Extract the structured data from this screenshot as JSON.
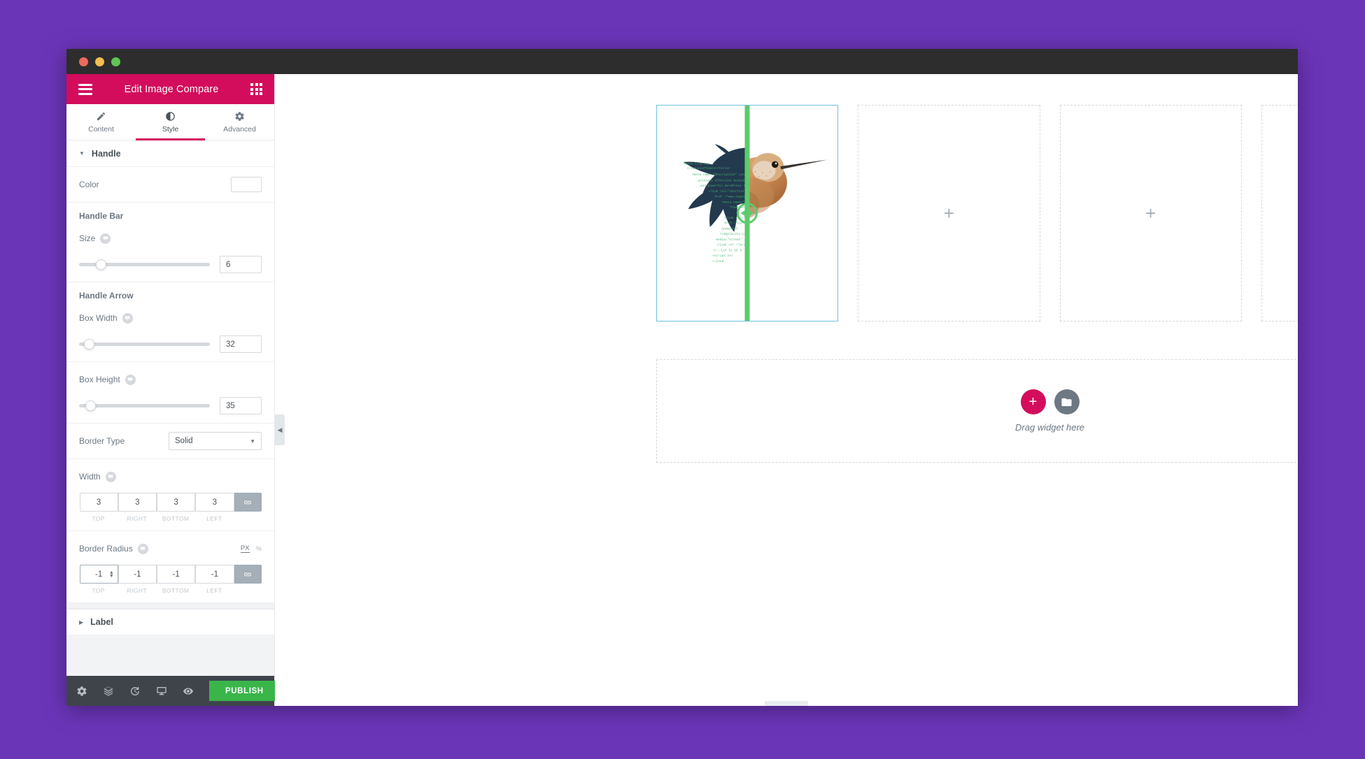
{
  "window": {
    "traffic_lights": [
      "close",
      "minimize",
      "maximize"
    ]
  },
  "panel": {
    "header": {
      "title": "Edit Image Compare",
      "menu_icon": "hamburger-icon",
      "widgets_icon": "grid-icon"
    },
    "tabs": [
      {
        "id": "content",
        "label": "Content",
        "icon": "pencil-icon",
        "active": false
      },
      {
        "id": "style",
        "label": "Style",
        "icon": "contrast-icon",
        "active": true
      },
      {
        "id": "advanced",
        "label": "Advanced",
        "icon": "gear-icon",
        "active": false
      }
    ],
    "sections": [
      {
        "id": "handle",
        "title": "Handle",
        "expanded": true
      },
      {
        "id": "label",
        "title": "Label",
        "expanded": false
      }
    ],
    "controls": {
      "color": {
        "label": "Color",
        "value": "#5CCB6B"
      },
      "handle_bar_group": "Handle Bar",
      "size": {
        "label": "Size",
        "value": "6",
        "slider_percent": 14
      },
      "handle_arrow_group": "Handle Arrow",
      "box_width": {
        "label": "Box Width",
        "value": "32",
        "slider_percent": 4
      },
      "box_height": {
        "label": "Box Height",
        "value": "35",
        "slider_percent": 5
      },
      "border_type": {
        "label": "Border Type",
        "value": "Solid"
      },
      "width": {
        "label": "Width",
        "values": [
          "3",
          "3",
          "3",
          "3"
        ],
        "captions": [
          "TOP",
          "RIGHT",
          "BOTTOM",
          "LEFT"
        ],
        "linked": true
      },
      "border_radius": {
        "label": "Border Radius",
        "values": [
          "-1",
          "-1",
          "-1",
          "-1"
        ],
        "captions": [
          "TOP",
          "RIGHT",
          "BOTTOM",
          "LEFT"
        ],
        "linked": true,
        "units": [
          {
            "label": "PX",
            "active": true
          },
          {
            "label": "%",
            "active": false
          }
        ]
      }
    },
    "footer": {
      "icons": [
        {
          "name": "settings-gear-icon"
        },
        {
          "name": "navigator-layers-icon"
        },
        {
          "name": "history-clock-icon"
        },
        {
          "name": "responsive-monitor-icon"
        },
        {
          "name": "preview-eye-icon"
        }
      ],
      "publish_label": "PUBLISH",
      "publish_color": "#39B54A"
    },
    "collapse_tab_icon": "chevron-left-icon"
  },
  "canvas": {
    "columns": [
      {
        "id": "col-1",
        "type": "image-compare",
        "selected": true,
        "placeholder": ""
      },
      {
        "id": "col-2",
        "type": "empty",
        "placeholder": "+"
      },
      {
        "id": "col-3",
        "type": "empty",
        "placeholder": "+"
      },
      {
        "id": "col-4",
        "type": "empty",
        "placeholder": "+"
      }
    ],
    "image_compare": {
      "handle_color": "#5CCB6B",
      "split_percent": 50,
      "left_image_alt": "code-silhouette-hummingbird",
      "right_image_alt": "photo-hummingbird"
    },
    "dropzone": {
      "add_label": "+",
      "folder_icon": "folder-icon",
      "text": "Drag widget here"
    }
  },
  "theme": {
    "accent": "#D30C5C",
    "background": "#6B35B8",
    "selection_outline": "#6EC1E4",
    "panel_footer": "#3F444B"
  }
}
